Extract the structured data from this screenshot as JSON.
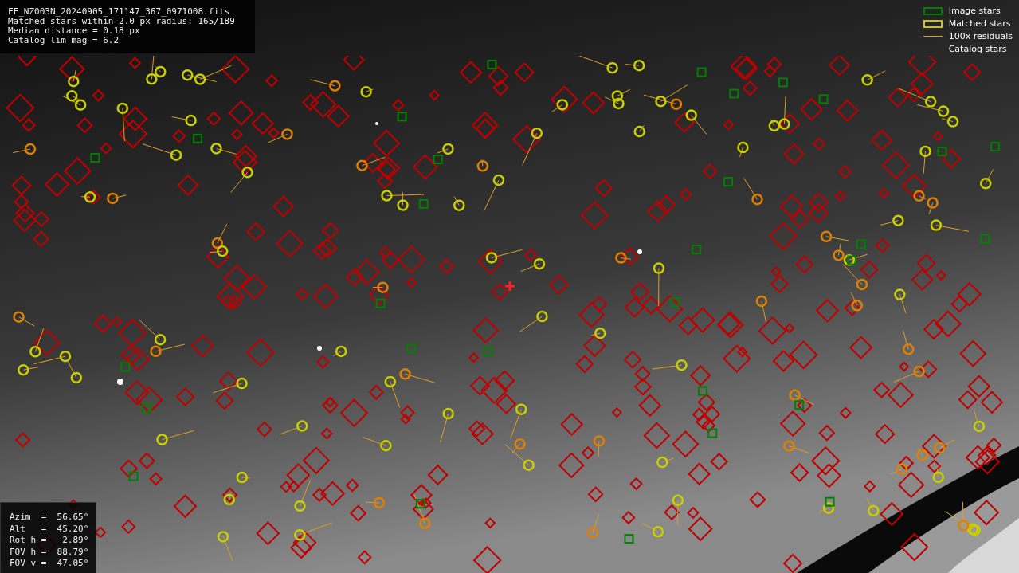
{
  "file_info": {
    "lines": [
      "FF_NZ003N_20240905_171147_367_0971008.fits",
      "Matched stars within 2.0 px radius: 165/189",
      "Median distance = 0.18 px",
      "Catalog lim mag = 6.2"
    ]
  },
  "legend": [
    {
      "label": "Image stars"
    },
    {
      "kind": "matched",
      "label": "Matched stars"
    },
    {
      "kind": "residual",
      "label": "100x residuals"
    },
    {
      "kind": "catalog",
      "label": "Catalog stars"
    }
  ],
  "pointing": {
    "lines": [
      "Azim  =  56.65°",
      "Alt   =  45.20°",
      "Rot h =   2.89°",
      "FOV h =  88.79°",
      "FOV v =  47.05°"
    ]
  }
}
